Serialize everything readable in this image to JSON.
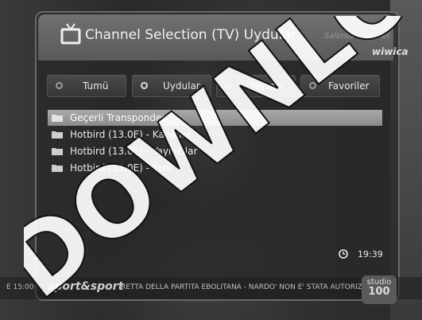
{
  "header": {
    "title": "Channel Selection  (TV) Uydular",
    "logo_top": "Salento  Channel",
    "logo_bottom": "wiwica"
  },
  "tabs": [
    {
      "label": "Tumü",
      "selected": false
    },
    {
      "label": "Uydular",
      "selected": true
    },
    {
      "label": "Yayıncı",
      "selected": false
    },
    {
      "label": "Favoriler",
      "selected": false
    }
  ],
  "list": {
    "items": [
      {
        "label": "Geçerli Transponder",
        "active": true
      },
      {
        "label": "Hotbird (13.0E) - Kanallar",
        "active": false
      },
      {
        "label": "Hotbird (13.0E) - Yayıncılar",
        "active": false
      },
      {
        "label": "Hotbird (13.0E) - Yeni",
        "active": false
      }
    ]
  },
  "status": {
    "time": "19:39"
  },
  "ticker": {
    "left": "E 15:00",
    "brand": "sport&sport",
    "text": "RETTA DELLA PARTITA EBOLITANA - NARDO' NON E' STATA AUTORIZZATA",
    "studio_top": "studio",
    "studio_bottom": "100"
  },
  "watermark": {
    "text": "DOWNLOAD"
  },
  "colors": {
    "highlight": "#a8a8a8",
    "panel": "#3a3a3a",
    "text": "#e6e6e6"
  }
}
